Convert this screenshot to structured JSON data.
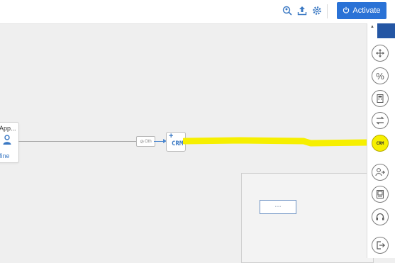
{
  "header": {
    "activate_label": "Activate",
    "icons": [
      "search-user-icon",
      "upload-icon",
      "settings-icon",
      "power-icon"
    ]
  },
  "canvas": {
    "source_node": {
      "title": "App...",
      "subtitle": "fine"
    },
    "condition_chip": {
      "label": "Oth"
    },
    "target_node": {
      "label": "CRM"
    },
    "highlight_color": "#f6ef00"
  },
  "toolbox": {
    "tools": [
      {
        "name": "move-tool",
        "icon": "move-icon"
      },
      {
        "name": "percent-tool",
        "icon": "percent-icon"
      },
      {
        "name": "calculator-tool",
        "icon": "calculator-icon"
      },
      {
        "name": "route-tool",
        "icon": "route-icon"
      },
      {
        "name": "crm-tool",
        "icon": "crm-icon",
        "label": "CRM",
        "active": true
      },
      {
        "name": "transfer-tool",
        "icon": "transfer-icon"
      },
      {
        "name": "screen-tool",
        "icon": "screen-icon"
      },
      {
        "name": "agent-tool",
        "icon": "headset-icon"
      },
      {
        "name": "exit-tool",
        "icon": "exit-icon"
      }
    ]
  },
  "colors": {
    "accent": "#2a72d6",
    "link": "#3a78c3",
    "highlight": "#f6ef00"
  }
}
